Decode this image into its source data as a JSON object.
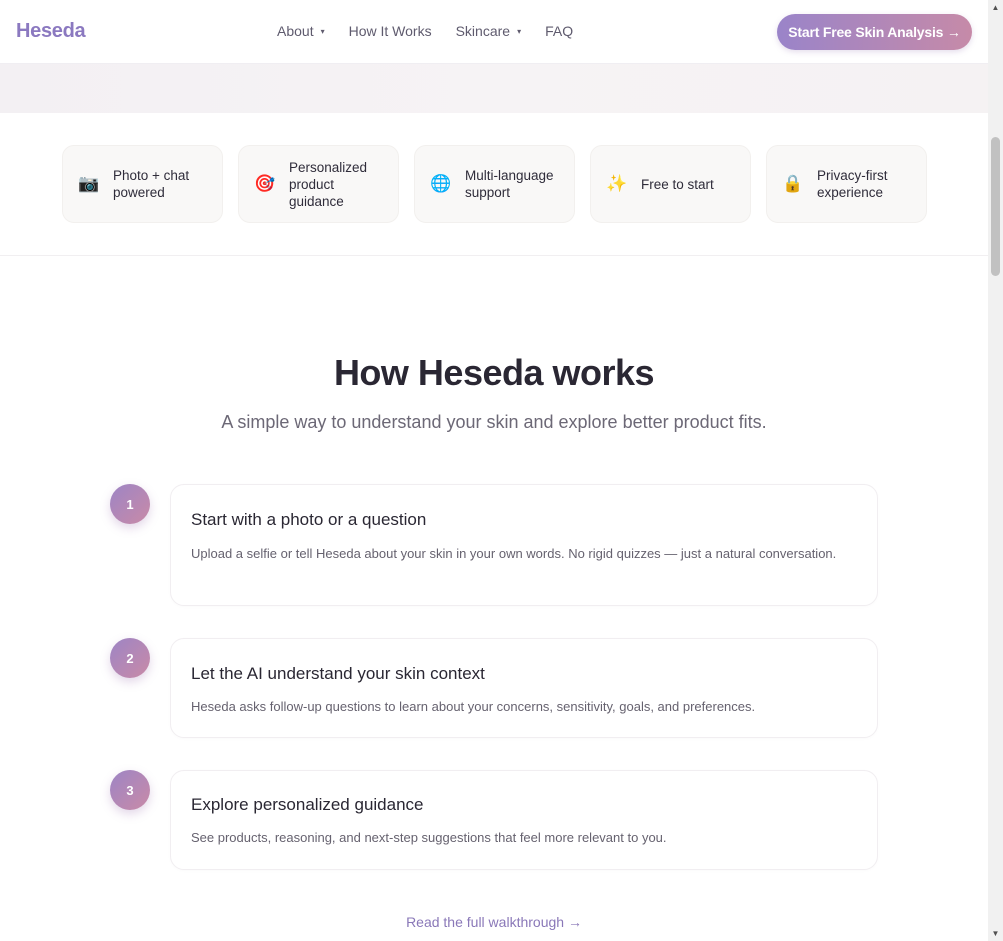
{
  "header": {
    "logo": "Heseda",
    "nav": [
      {
        "label": "About",
        "caret": "▾"
      },
      {
        "label": "How It Works"
      },
      {
        "label": "Skincare",
        "caret": "▾"
      },
      {
        "label": "FAQ"
      }
    ],
    "cta_label": "Start Free Skin Analysis →"
  },
  "features": [
    {
      "icon": "📷",
      "icon_name": "camera-icon",
      "label": "Photo + chat powered"
    },
    {
      "icon": "🎯",
      "icon_name": "target-icon",
      "label": "Personalized product guidance"
    },
    {
      "icon": "🌐",
      "icon_name": "globe-icon",
      "label": "Multi-language support"
    },
    {
      "icon": "✨",
      "icon_name": "sparkles-icon",
      "label": "Free to start"
    },
    {
      "icon": "🔒",
      "icon_name": "lock-icon",
      "label": "Privacy-first experience"
    }
  ],
  "how": {
    "title": "How Heseda works",
    "subtitle": "A simple way to understand your skin and explore better product fits.",
    "steps": [
      {
        "num": "1",
        "title": "Start with a photo or a question",
        "desc": "Upload a selfie or tell Heseda about your skin in your own words. No rigid quizzes — just a natural conversation."
      },
      {
        "num": "2",
        "title": "Let the AI understand your skin context",
        "desc": "Heseda asks follow-up questions to learn about your concerns, sensitivity, goals, and preferences."
      },
      {
        "num": "3",
        "title": "Explore personalized guidance",
        "desc": "See products, reasoning, and next-step suggestions that feel more relevant to you."
      }
    ],
    "link": "Read the full walkthrough →"
  },
  "scrollbar": {
    "up": "▲",
    "down": "▼"
  },
  "colors": {
    "brand": "#8b79c0",
    "accent_pink": "#c98aa7"
  }
}
